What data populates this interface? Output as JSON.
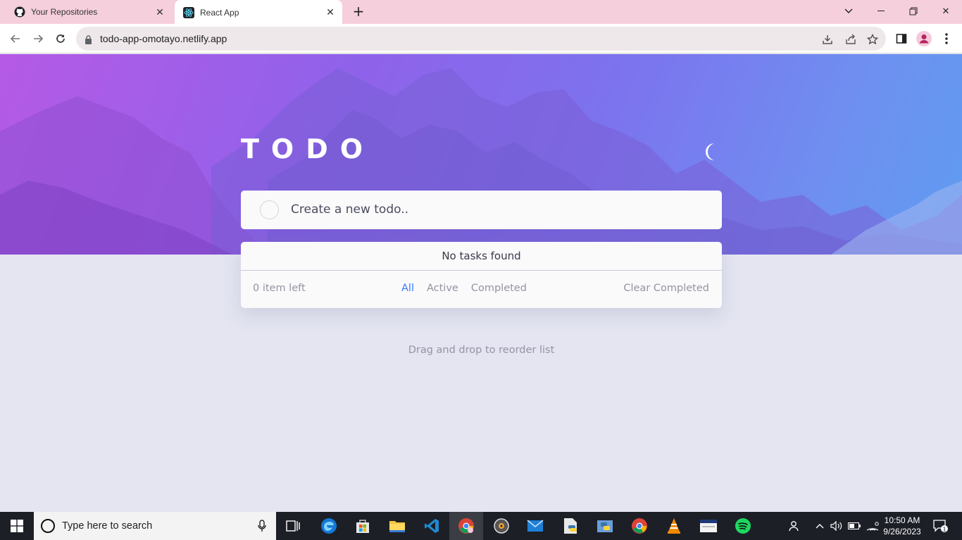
{
  "browser": {
    "tabs": [
      {
        "title": "Your Repositories",
        "icon": "github-icon",
        "active": false
      },
      {
        "title": "React App",
        "icon": "react-icon",
        "active": true
      }
    ],
    "url": "todo-app-omotayo.netlify.app"
  },
  "app": {
    "title": "TODO",
    "input_placeholder": "Create a new todo..",
    "empty_message": "No tasks found",
    "items_left": "0 item left",
    "filters": [
      "All",
      "Active",
      "Completed"
    ],
    "active_filter": "All",
    "clear_label": "Clear Completed",
    "hint": "Drag and drop to reorder list"
  },
  "taskbar": {
    "search_placeholder": "Type here to search",
    "time": "10:50 AM",
    "date": "9/26/2023",
    "notification_count": "1"
  },
  "colors": {
    "accent": "#3a7bfd",
    "page_bg": "#e4e5f1",
    "card_bg": "#fafafa",
    "hero_start": "#b55ae6",
    "hero_end": "#5f9cf1"
  }
}
